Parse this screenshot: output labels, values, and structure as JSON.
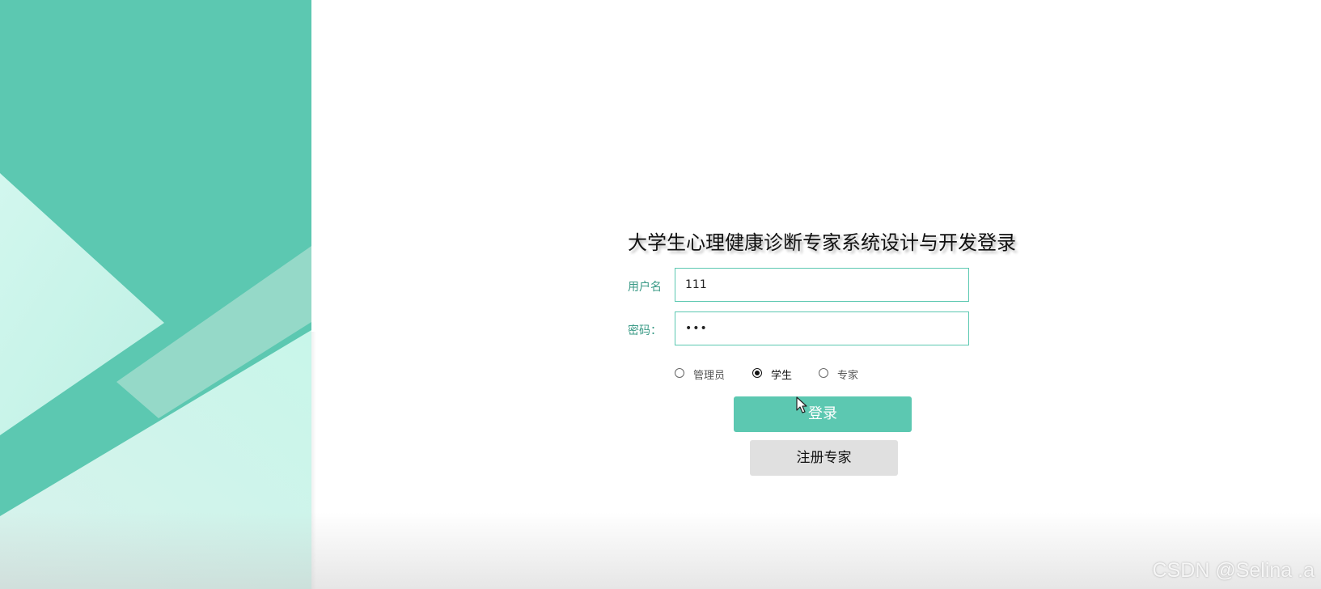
{
  "page": {
    "title": "大学生心理健康诊断专家系统设计与开发登录"
  },
  "form": {
    "username_label": "用户名",
    "username_value": "111",
    "password_label": "密码：",
    "password_value": "•••",
    "roles": [
      {
        "label": "管理员",
        "checked": false
      },
      {
        "label": "学生",
        "checked": true
      },
      {
        "label": "专家",
        "checked": false
      }
    ],
    "login_label": "登录",
    "register_label": "注册专家"
  },
  "watermark": "CSDN @Selina .a",
  "colors": {
    "accent": "#5cc8b1",
    "light_mint": "#c9f5ea",
    "secondary_button": "#e0e0e0"
  },
  "icons": {
    "cursor": "arrow-cursor-icon"
  }
}
